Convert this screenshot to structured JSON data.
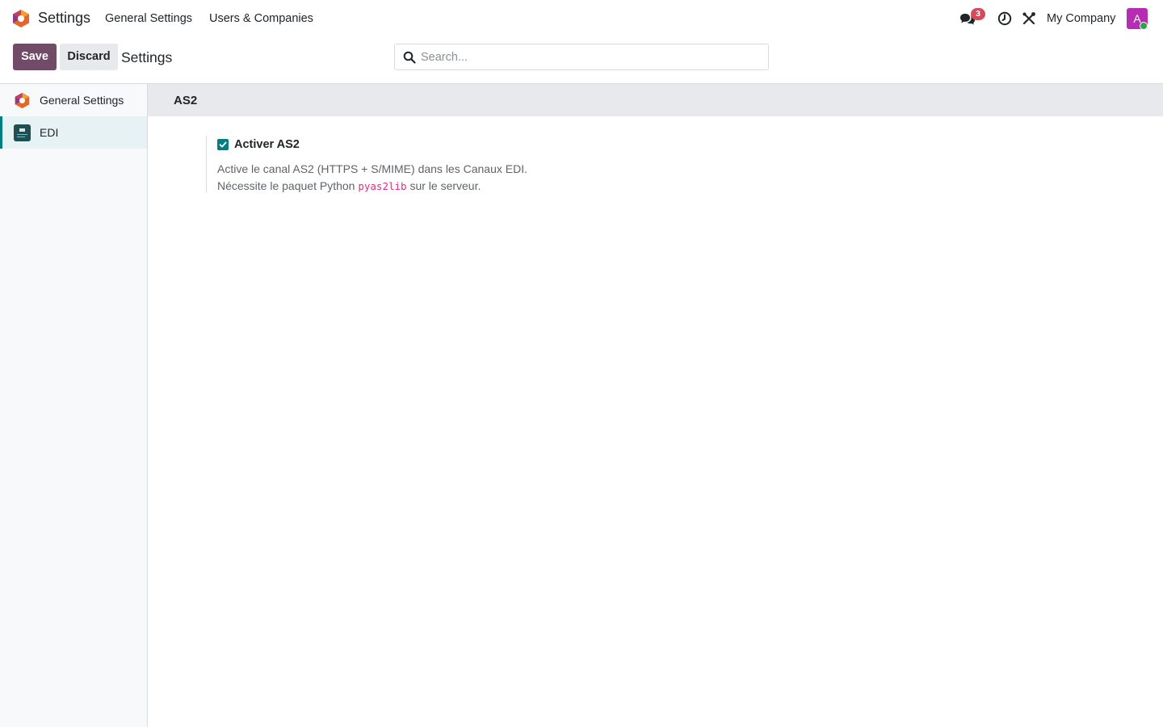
{
  "navbar": {
    "app_name": "Settings",
    "menus": [
      "General Settings",
      "Users & Companies"
    ],
    "messages_badge": "3",
    "company": "My Company",
    "avatar_initial": "A",
    "icons": {
      "chat": "chat-icon",
      "activity": "clock-icon",
      "debug": "tools-icon"
    }
  },
  "control_panel": {
    "save_label": "Save",
    "discard_label": "Discard",
    "breadcrumb": "Settings",
    "search_placeholder": "Search..."
  },
  "sidebar": {
    "items": [
      {
        "label": "General Settings",
        "icon": "odoo-logo-icon",
        "active": false
      },
      {
        "label": "EDI",
        "icon": "edi-app-icon",
        "active": true
      }
    ]
  },
  "main": {
    "section_title": "AS2",
    "setting": {
      "label": "Activer AS2",
      "checked": true,
      "description_line1": "Active le canal AS2 (HTTPS + S/MIME) dans les Canaux EDI.",
      "description_line2_before": "Nécessite le paquet Python",
      "description_code": "pyas2lib",
      "description_line2_after": "sur le serveur."
    }
  },
  "colors": {
    "brand": "#714b67",
    "accent_teal": "#017e84",
    "badge": "#d44c59",
    "avatar": "#b62cb3",
    "code": "#d63384"
  }
}
